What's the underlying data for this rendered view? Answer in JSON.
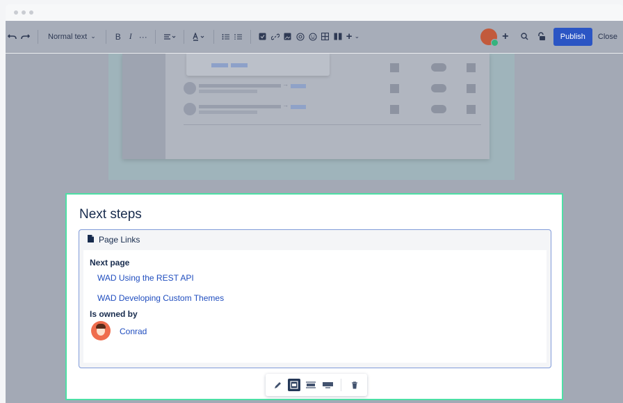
{
  "toolbar": {
    "text_style": "Normal text",
    "bold": "B",
    "italic": "I",
    "more": "···",
    "publish": "Publish",
    "close": "Close"
  },
  "macro": {
    "title": "Next steps",
    "panel_title": "Page Links",
    "next_page_label": "Next page",
    "links": [
      "WAD Using the REST API",
      "WAD Developing Custom Themes"
    ],
    "owned_label": "Is owned by",
    "owner": "Conrad"
  },
  "colors": {
    "accent": "#2b55c4",
    "selection_border": "#4ddfa5",
    "link": "#1f4dbf"
  }
}
